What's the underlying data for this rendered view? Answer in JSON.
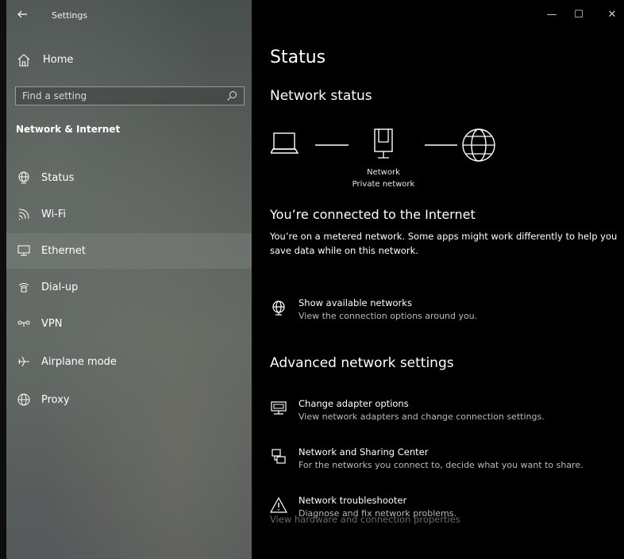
{
  "window": {
    "title": "Settings",
    "minimize": "—",
    "maximize": "☐",
    "close": "✕"
  },
  "sidebar": {
    "home_label": "Home",
    "search_placeholder": "Find a setting",
    "section_title": "Network & Internet",
    "items": [
      {
        "label": "Status",
        "icon": "globe-status-icon"
      },
      {
        "label": "Wi-Fi",
        "icon": "wifi-icon"
      },
      {
        "label": "Ethernet",
        "icon": "ethernet-icon",
        "selected": true
      },
      {
        "label": "Dial-up",
        "icon": "dialup-icon"
      },
      {
        "label": "VPN",
        "icon": "vpn-icon"
      },
      {
        "label": "Airplane mode",
        "icon": "airplane-icon"
      },
      {
        "label": "Proxy",
        "icon": "proxy-globe-icon"
      }
    ]
  },
  "main": {
    "title": "Status",
    "network_status_heading": "Network status",
    "diagram": {
      "network_name": "Network",
      "network_type": "Private network"
    },
    "connected_heading": "You’re connected to the Internet",
    "connected_body": "You’re on a metered network. Some apps might work differently to help you save data while on this network.",
    "show_networks": {
      "title": "Show available networks",
      "subtitle": "View the connection options around you."
    },
    "advanced_heading": "Advanced network settings",
    "advanced_links": [
      {
        "title": "Change adapter options",
        "subtitle": "View network adapters and change connection settings.",
        "icon": "adapter-icon"
      },
      {
        "title": "Network and Sharing Center",
        "subtitle": "For the networks you connect to, decide what you want to share.",
        "icon": "sharing-center-icon"
      },
      {
        "title": "Network troubleshooter",
        "subtitle": "Diagnose and fix network problems.",
        "icon": "warning-icon"
      }
    ],
    "footer_link": "View hardware and connection properties"
  }
}
